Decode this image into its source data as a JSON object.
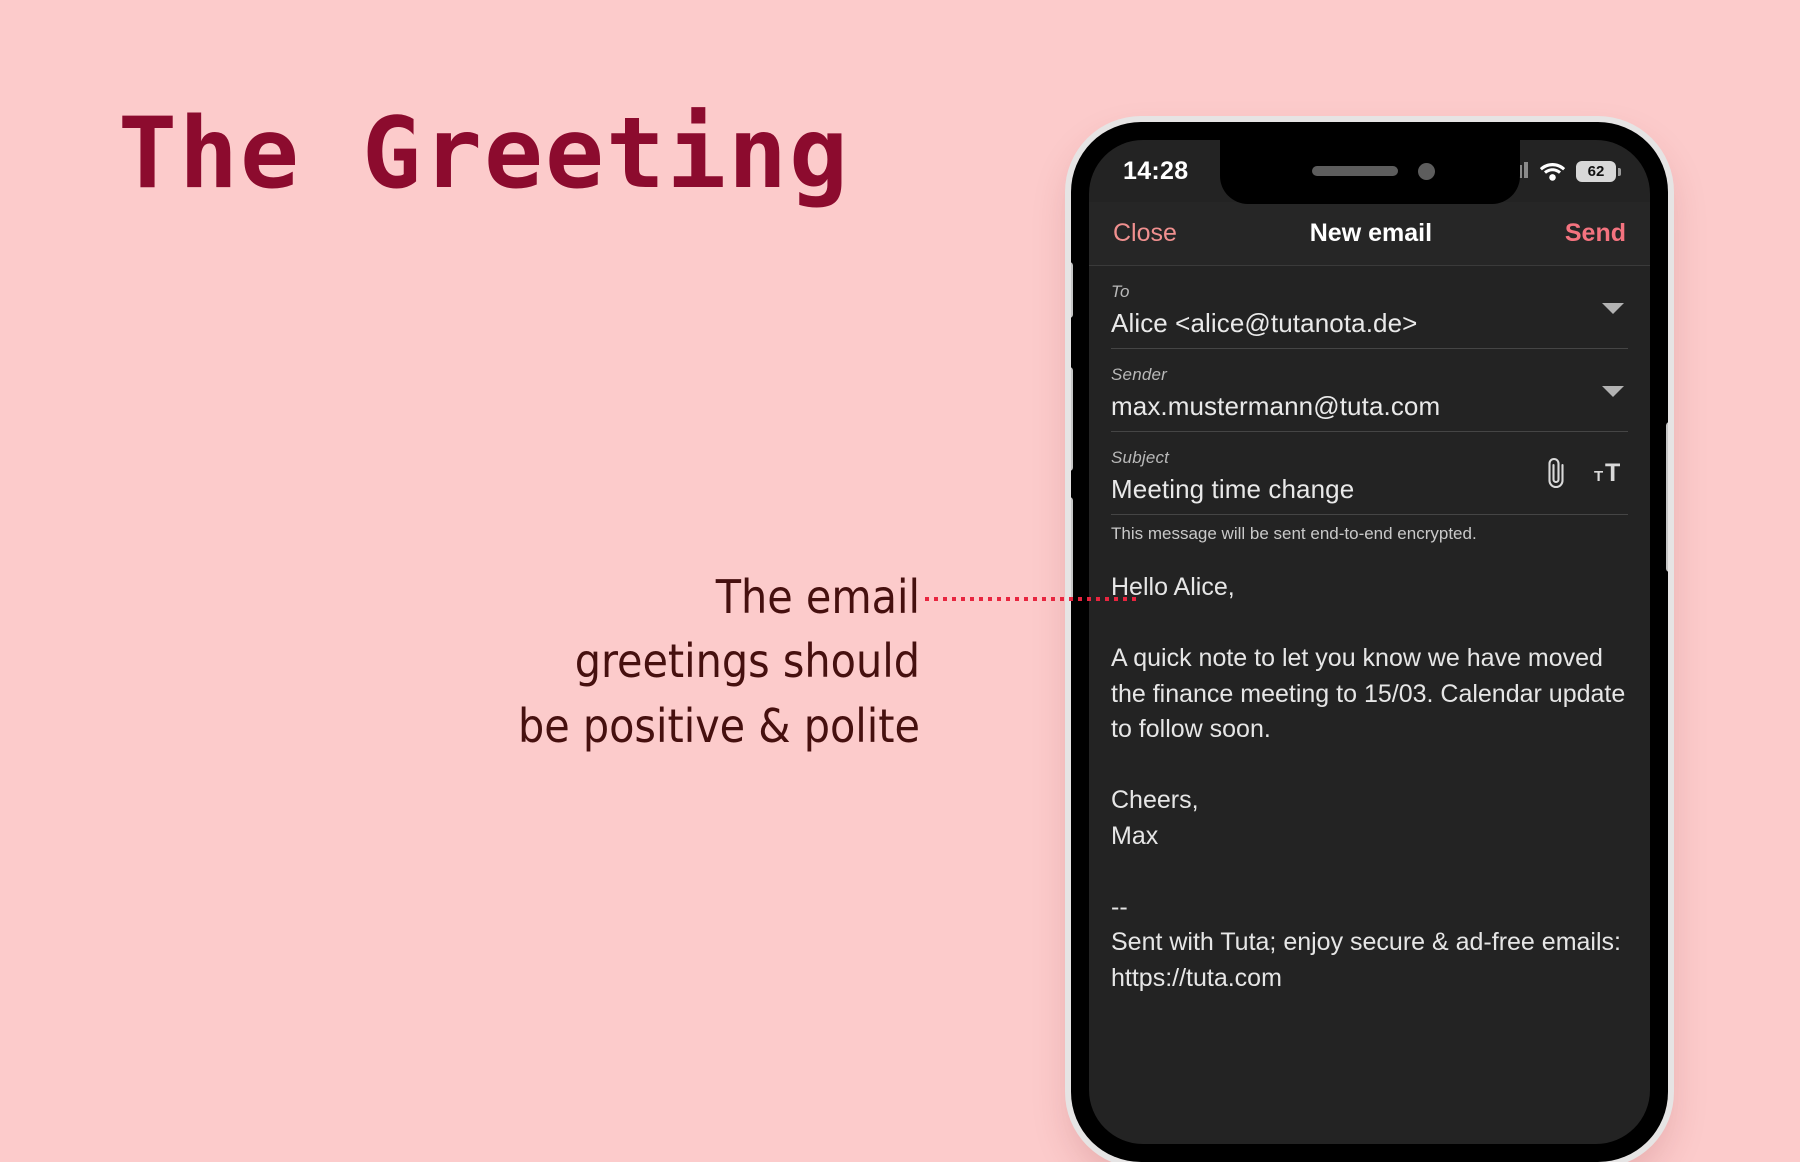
{
  "slide": {
    "background_color": "#fccbcb",
    "headline": "The Greeting",
    "headline_color": "#8c0b2e",
    "annotation": "The email\ngreetings should\nbe positive & polite",
    "annotation_color": "#46100f",
    "connector_color": "#e8253f"
  },
  "phone": {
    "status_bar": {
      "time": "14:28",
      "signal_icon": "cellular-signal-icon",
      "wifi_icon": "wifi-icon",
      "battery_level": "62",
      "battery_icon": "battery-icon"
    },
    "navbar": {
      "close_label": "Close",
      "title": "New email",
      "send_label": "Send",
      "close_color": "#f0908f",
      "send_color": "#f4737f"
    },
    "compose": {
      "to": {
        "label": "To",
        "value": "Alice <alice@tutanota.de>",
        "dropdown_icon": "chevron-down-icon"
      },
      "sender": {
        "label": "Sender",
        "value": "max.mustermann@tuta.com",
        "dropdown_icon": "chevron-down-icon"
      },
      "subject": {
        "label": "Subject",
        "value": "Meeting time change",
        "attach_icon": "paperclip-icon",
        "font_size_icon": "font-size-icon"
      },
      "encryption_note": "This message will be sent end-to-end encrypted.",
      "body": "Hello Alice,\n\nA quick note to let you know we have moved the finance meeting to 15/03. Calendar update to follow soon.\n\nCheers,\nMax\n\n--\nSent with Tuta; enjoy secure & ad-free emails: https://tuta.com"
    }
  }
}
